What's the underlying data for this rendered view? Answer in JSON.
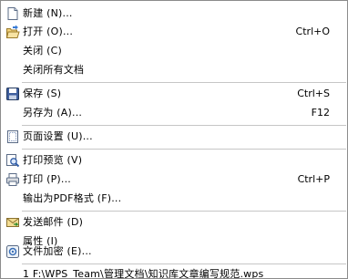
{
  "menu": {
    "items": [
      {
        "label": "新建 (N)...",
        "shortcut": "",
        "icon": "new-document-icon"
      },
      {
        "label": "打开 (O)...",
        "shortcut": "Ctrl+O",
        "icon": "open-folder-icon"
      },
      {
        "label": "关闭 (C)",
        "shortcut": "",
        "icon": ""
      },
      {
        "label": "关闭所有文档",
        "shortcut": "",
        "icon": ""
      },
      {
        "label": "保存 (S)",
        "shortcut": "Ctrl+S",
        "icon": "save-disk-icon"
      },
      {
        "label": "另存为 (A)...",
        "shortcut": "F12",
        "icon": ""
      },
      {
        "label": "页面设置 (U)...",
        "shortcut": "",
        "icon": "page-setup-icon"
      },
      {
        "label": "打印预览 (V)",
        "shortcut": "",
        "icon": "print-preview-icon"
      },
      {
        "label": "打印 (P)...",
        "shortcut": "Ctrl+P",
        "icon": "printer-icon"
      },
      {
        "label": "输出为PDF格式 (F)...",
        "shortcut": "",
        "icon": ""
      },
      {
        "label": "发送邮件 (D)",
        "shortcut": "",
        "icon": "send-mail-icon"
      },
      {
        "label": "属性 (I)",
        "shortcut": "",
        "icon": ""
      },
      {
        "label": "文件加密 (E)...",
        "shortcut": "",
        "icon": "file-encrypt-icon"
      }
    ],
    "recent": {
      "label": "1 F:\\WPS_Team\\管理文档\\知识库文章编写规范.wps"
    }
  }
}
